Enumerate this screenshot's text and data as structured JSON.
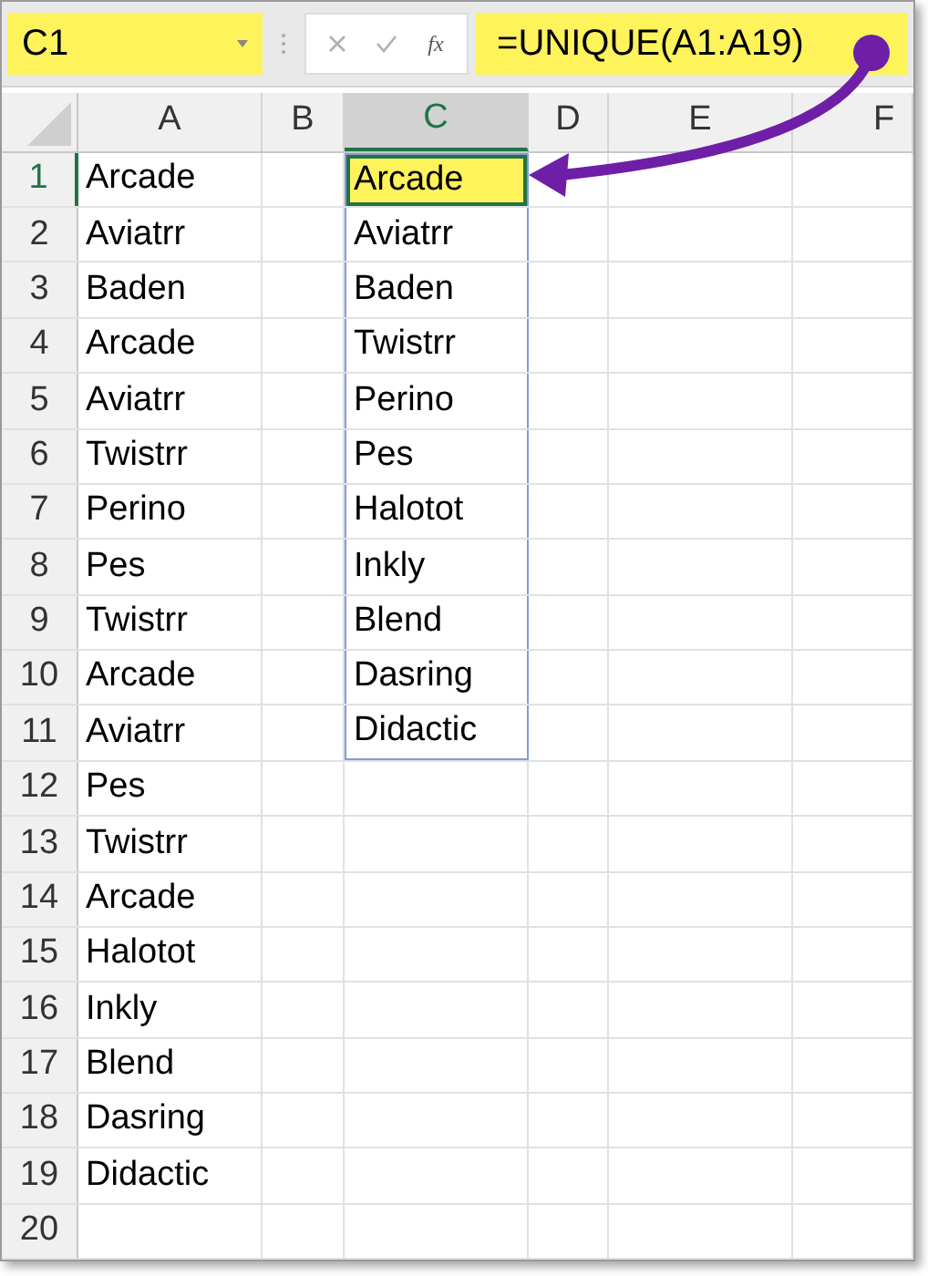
{
  "name_box": {
    "value": "C1",
    "highlighted": true
  },
  "formula_bar": {
    "function_label": "fx",
    "formula": "=UNIQUE(A1:A19)",
    "highlighted": true
  },
  "columns": [
    {
      "label": "A",
      "selected": false
    },
    {
      "label": "B",
      "selected": false
    },
    {
      "label": "C",
      "selected": true
    },
    {
      "label": "D",
      "selected": false
    },
    {
      "label": "E",
      "selected": false
    },
    {
      "label": "F",
      "selected": false
    }
  ],
  "rows": [
    {
      "number": "1",
      "selected": true,
      "A": "Arcade",
      "C": {
        "text": "Arcade",
        "selected": true,
        "spill": true
      }
    },
    {
      "number": "2",
      "selected": false,
      "A": "Aviatrr",
      "C": {
        "text": "Aviatrr",
        "selected": false,
        "spill": true
      }
    },
    {
      "number": "3",
      "selected": false,
      "A": "Baden",
      "C": {
        "text": "Baden",
        "selected": false,
        "spill": true
      }
    },
    {
      "number": "4",
      "selected": false,
      "A": "Arcade",
      "C": {
        "text": "Twistrr",
        "selected": false,
        "spill": true
      }
    },
    {
      "number": "5",
      "selected": false,
      "A": "Aviatrr",
      "C": {
        "text": "Perino",
        "selected": false,
        "spill": true
      }
    },
    {
      "number": "6",
      "selected": false,
      "A": "Twistrr",
      "C": {
        "text": "Pes",
        "selected": false,
        "spill": true
      }
    },
    {
      "number": "7",
      "selected": false,
      "A": "Perino",
      "C": {
        "text": "Halotot",
        "selected": false,
        "spill": true
      }
    },
    {
      "number": "8",
      "selected": false,
      "A": "Pes",
      "C": {
        "text": "Inkly",
        "selected": false,
        "spill": true
      }
    },
    {
      "number": "9",
      "selected": false,
      "A": "Twistrr",
      "C": {
        "text": "Blend",
        "selected": false,
        "spill": true
      }
    },
    {
      "number": "10",
      "selected": false,
      "A": "Arcade",
      "C": {
        "text": "Dasring",
        "selected": false,
        "spill": true
      }
    },
    {
      "number": "11",
      "selected": false,
      "A": "Aviatrr",
      "C": {
        "text": "Didactic",
        "selected": false,
        "spill": true
      }
    },
    {
      "number": "12",
      "selected": false,
      "A": "Pes"
    },
    {
      "number": "13",
      "selected": false,
      "A": "Twistrr"
    },
    {
      "number": "14",
      "selected": false,
      "A": "Arcade"
    },
    {
      "number": "15",
      "selected": false,
      "A": "Halotot"
    },
    {
      "number": "16",
      "selected": false,
      "A": "Inkly"
    },
    {
      "number": "17",
      "selected": false,
      "A": "Blend"
    },
    {
      "number": "18",
      "selected": false,
      "A": "Dasring"
    },
    {
      "number": "19",
      "selected": false,
      "A": "Didactic"
    },
    {
      "number": "20",
      "selected": false
    }
  ]
}
